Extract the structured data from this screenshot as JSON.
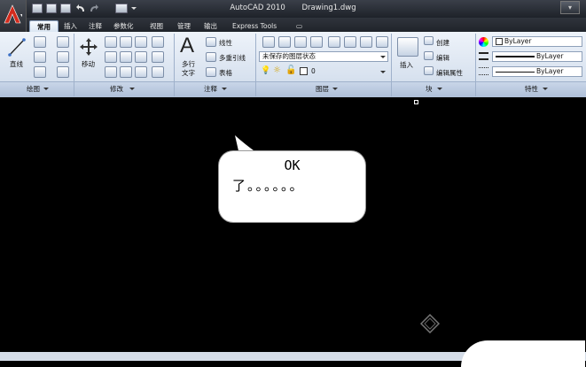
{
  "window": {
    "app_title": "AutoCAD 2010",
    "doc_title": "Drawing1.dwg",
    "title_button": "▾"
  },
  "tabs": [
    {
      "label": "常用",
      "active": true
    },
    {
      "label": "插入"
    },
    {
      "label": "注释"
    },
    {
      "label": "参数化"
    },
    {
      "label": "视图"
    },
    {
      "label": "管理"
    },
    {
      "label": "输出"
    },
    {
      "label": "Express Tools"
    },
    {
      "label": "▭"
    }
  ],
  "ribbon": {
    "draw": {
      "title": "绘图",
      "line_label": "直线"
    },
    "modify": {
      "title": "修改",
      "move_label": "移动"
    },
    "annotation": {
      "title": "注释",
      "mtext_label": "多行",
      "mtext_label2": "文字",
      "linear_label": "线性",
      "multileader_label": "多重引线",
      "table_label": "表格"
    },
    "layers": {
      "title": "图层",
      "layer_state": "未保存的图层状态",
      "current_layer": "0"
    },
    "block": {
      "title": "块",
      "insert_label": "插入",
      "create_label": "创建",
      "edit_label": "编辑",
      "edit_attr_label": "编辑属性"
    },
    "properties": {
      "title": "特性",
      "color": "ByLayer",
      "linetype": "ByLayer",
      "lineweight": "ByLayer"
    }
  },
  "bubble": {
    "line1": "OK",
    "line2": "了。。。。。。"
  },
  "colors": {
    "canvas": "#000000",
    "ribbon": "#dbe5f1",
    "titlebar": "#2a2e35",
    "logo": "#d42a1c"
  }
}
